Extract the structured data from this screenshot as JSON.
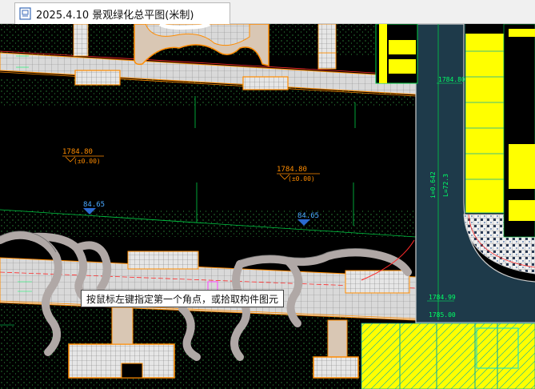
{
  "window": {
    "tab_title": "2025.4.10 景观绿化总平图(米制)",
    "tab_icon": "cad-drawing-icon"
  },
  "drawing": {
    "elevations": [
      {
        "id": "elev-1",
        "main": "1784.80",
        "sub": "(±0.00)"
      },
      {
        "id": "elev-2",
        "main": "1784.80",
        "sub": "(±0.00)"
      }
    ],
    "level_marks": [
      {
        "id": "lvl-1",
        "value": "84.65"
      },
      {
        "id": "lvl-2",
        "value": "84.65"
      }
    ],
    "road_labels": {
      "top": "1784.80",
      "bottom_1": "1784.99",
      "bottom_2": "1785.00",
      "vertical_1": "i=0.642",
      "vertical_2": "L=72.3"
    }
  },
  "tooltip": {
    "text": "按鼠标左键指定第一个角点，或拾取构件图元"
  },
  "colors": {
    "background": "#000000",
    "paving": "#d9d9d9",
    "paving_grid": "#8a8a8a",
    "path": "#b0a8a6",
    "orange": "#ff8c00",
    "yellow": "#ffff00",
    "road": "#1e3a4a",
    "green_line": "#00cc44",
    "cyan_line": "#00c8c8",
    "red_line": "#ff2a2a"
  }
}
